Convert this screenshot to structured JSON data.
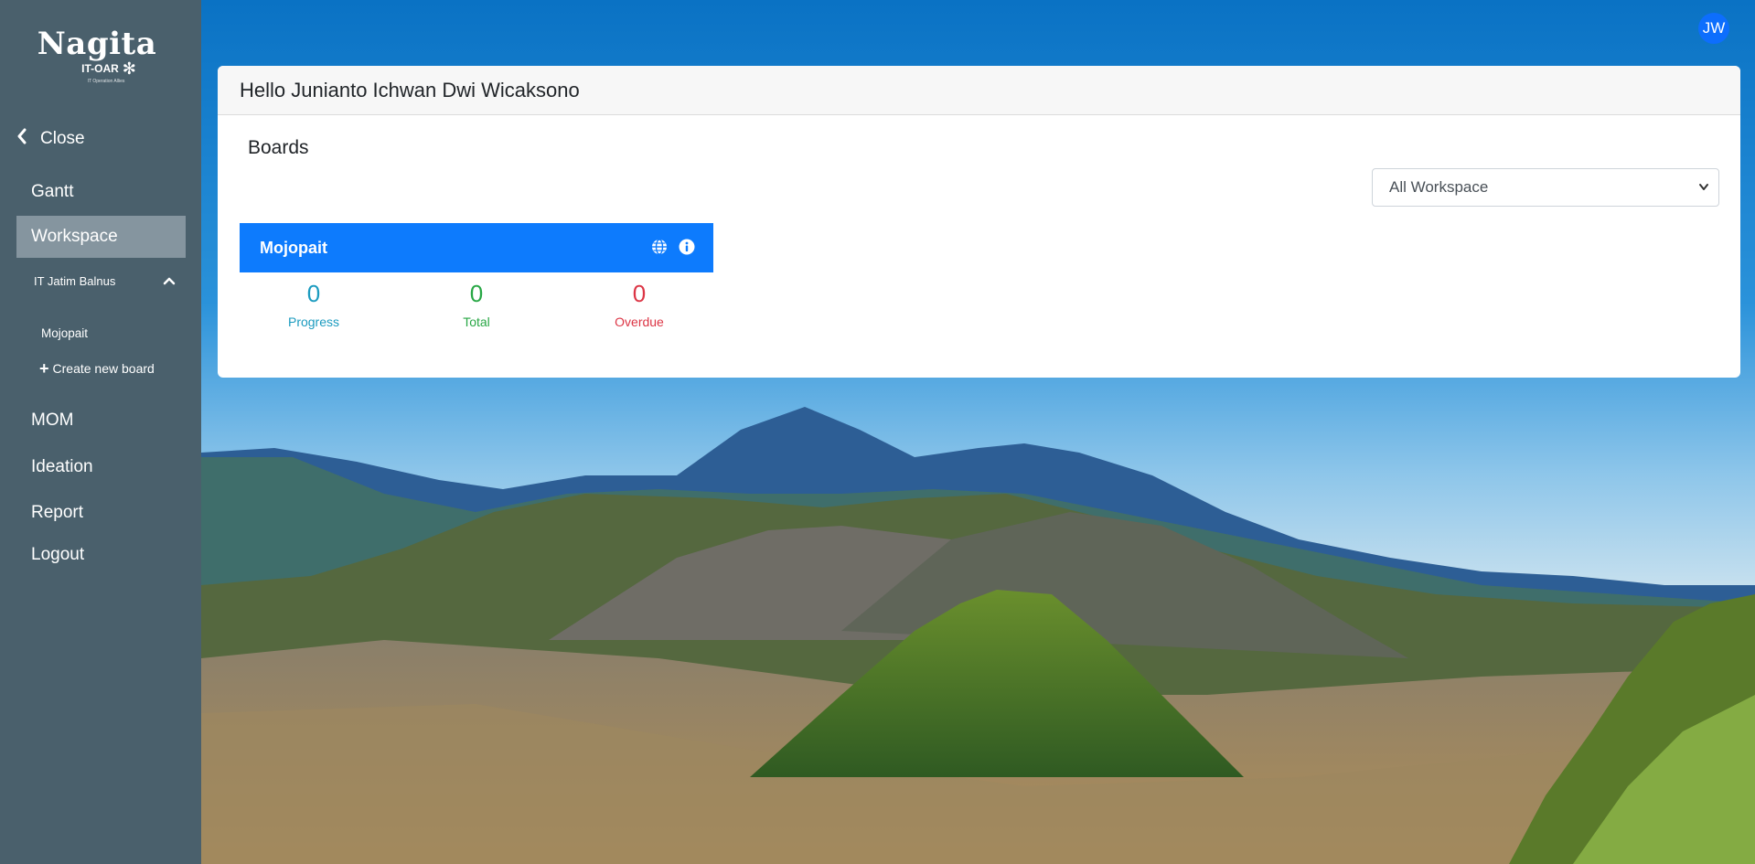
{
  "sidebar": {
    "logo": {
      "title": "Nagita",
      "subtitle": "IT-OAR",
      "tagline": "IT Operation Allies"
    },
    "close_label": "Close",
    "items": [
      {
        "label": "Gantt"
      },
      {
        "label": "Workspace"
      },
      {
        "label": "MOM"
      },
      {
        "label": "Ideation"
      },
      {
        "label": "Report"
      },
      {
        "label": "Logout"
      }
    ],
    "workspace": {
      "name": "IT Jatim Balnus",
      "boards": [
        "Mojopait"
      ],
      "create_label": "Create new board"
    }
  },
  "user": {
    "initials": "JW"
  },
  "main": {
    "greeting": "Hello Junianto Ichwan Dwi Wicaksono",
    "boards_title": "Boards",
    "workspace_filter": {
      "selected": "All Workspace"
    },
    "board": {
      "name": "Mojopait",
      "stats": {
        "progress": {
          "value": "0",
          "label": "Progress"
        },
        "total": {
          "value": "0",
          "label": "Total"
        },
        "overdue": {
          "value": "0",
          "label": "Overdue"
        }
      }
    }
  },
  "colors": {
    "sidebar_bg": "#4a606c",
    "sidebar_active": "#85959f",
    "board_header": "#0d7bfd",
    "progress": "#1b9bbf",
    "total": "#28a745",
    "overdue": "#dc3545",
    "avatar": "#0d6efd"
  }
}
